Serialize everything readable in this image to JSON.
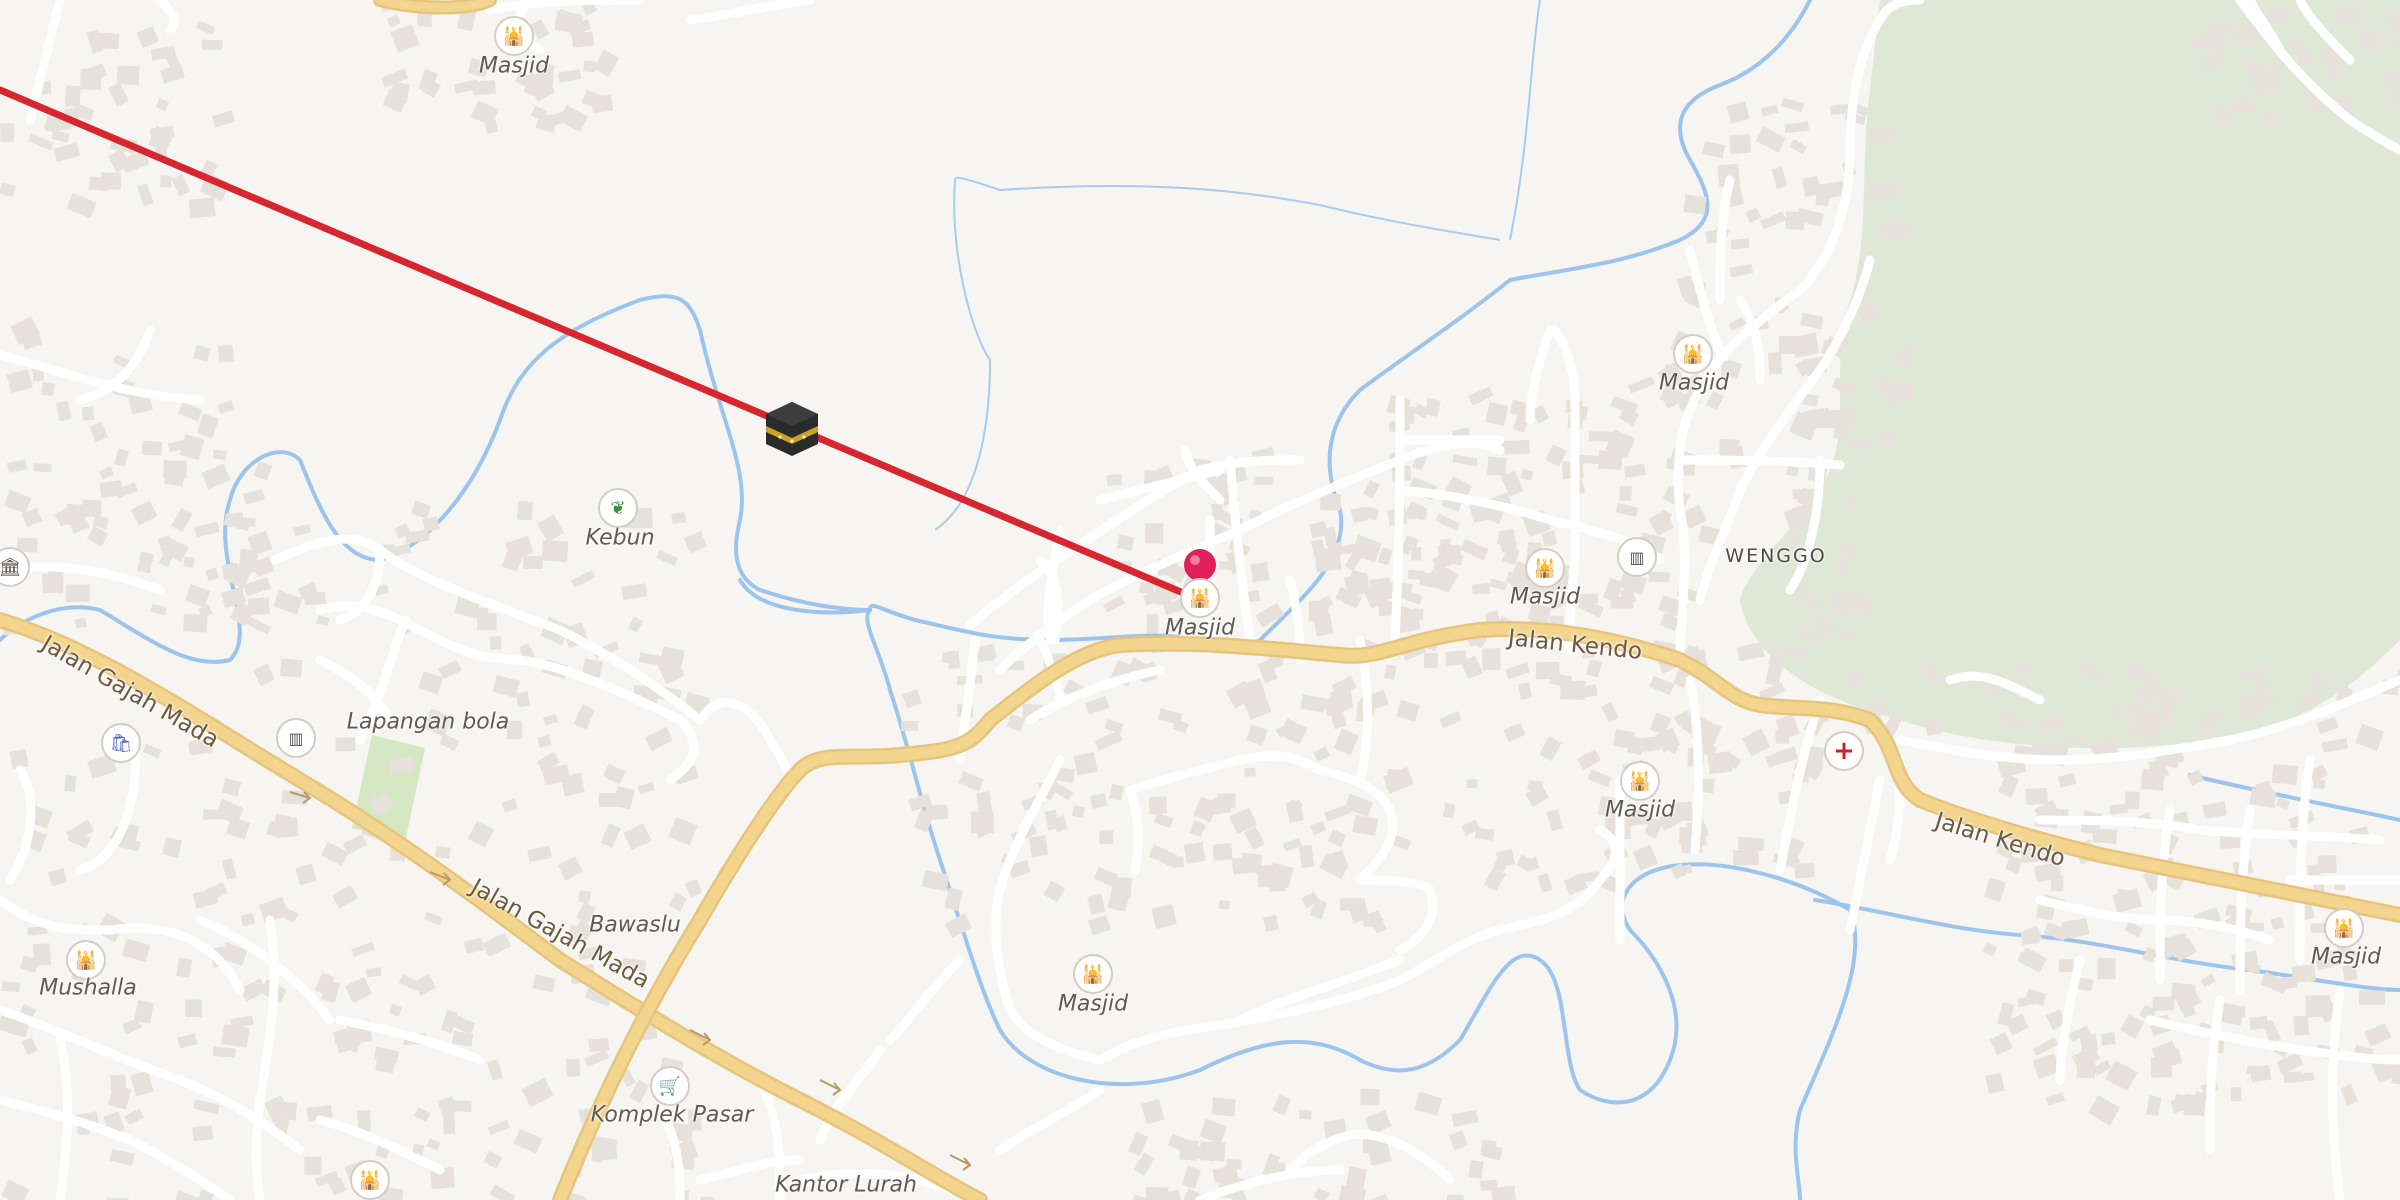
{
  "map": {
    "colors": {
      "background": "#f7f5f2",
      "building": "#e6e1da",
      "water": "#9cc4ec",
      "park": "#dfe8d6",
      "primary_road": "#f4d58e",
      "primary_road_casing": "#e7c47d",
      "minor_road": "#ffffff",
      "qibla_line": "#d7262f",
      "pin": "#e01f5b"
    },
    "qibla_marker": {
      "icon": "kaaba-icon"
    },
    "location_pin": {
      "icon": "map-pin-icon"
    },
    "poi_labels": [
      {
        "id": "masjid-top",
        "text": "Masjid",
        "icon": "mosque-icon"
      },
      {
        "id": "kebun",
        "text": "Kebun",
        "icon": "plant-icon"
      },
      {
        "id": "masjid-center",
        "text": "Masjid",
        "icon": "mosque-icon"
      },
      {
        "id": "masjid-east",
        "text": "Masjid",
        "icon": "mosque-icon"
      },
      {
        "id": "masjid-ne",
        "text": "Masjid",
        "icon": "mosque-icon"
      },
      {
        "id": "lapangan",
        "text": "Lapangan bola",
        "icon": ""
      },
      {
        "id": "masjid-se",
        "text": "Masjid",
        "icon": "mosque-icon"
      },
      {
        "id": "masjid-south",
        "text": "Masjid",
        "icon": "mosque-icon"
      },
      {
        "id": "masjid-far-east",
        "text": "Masjid",
        "icon": "mosque-icon"
      },
      {
        "id": "bawaslu",
        "text": "Bawaslu",
        "icon": ""
      },
      {
        "id": "mushalla",
        "text": "Mushalla",
        "icon": "mosque-icon"
      },
      {
        "id": "komplek-pasar",
        "text": "Komplek Pasar",
        "icon": "shopping-cart-icon"
      },
      {
        "id": "kantor-lurah",
        "text": "Kantor Lurah",
        "icon": ""
      }
    ],
    "place_labels": [
      {
        "id": "wenggo",
        "text": "WENGGO"
      }
    ],
    "road_labels": [
      {
        "id": "gajah-mada-1",
        "text": "Jalan Gajah Mada"
      },
      {
        "id": "gajah-mada-2",
        "text": "Jalan Gajah Mada"
      },
      {
        "id": "kendo-1",
        "text": "Jalan Kendo"
      },
      {
        "id": "kendo-2",
        "text": "Jalan Kendo"
      }
    ],
    "extra_icons": [
      {
        "id": "government-w",
        "icon": "government-building-icon"
      },
      {
        "id": "shopping-bag",
        "icon": "shopping-bag-icon"
      },
      {
        "id": "school-w",
        "icon": "school-icon"
      },
      {
        "id": "school-e",
        "icon": "school-icon"
      },
      {
        "id": "hospital",
        "icon": "medical-cross-icon"
      },
      {
        "id": "mosque-bottom",
        "icon": "mosque-icon"
      }
    ]
  }
}
